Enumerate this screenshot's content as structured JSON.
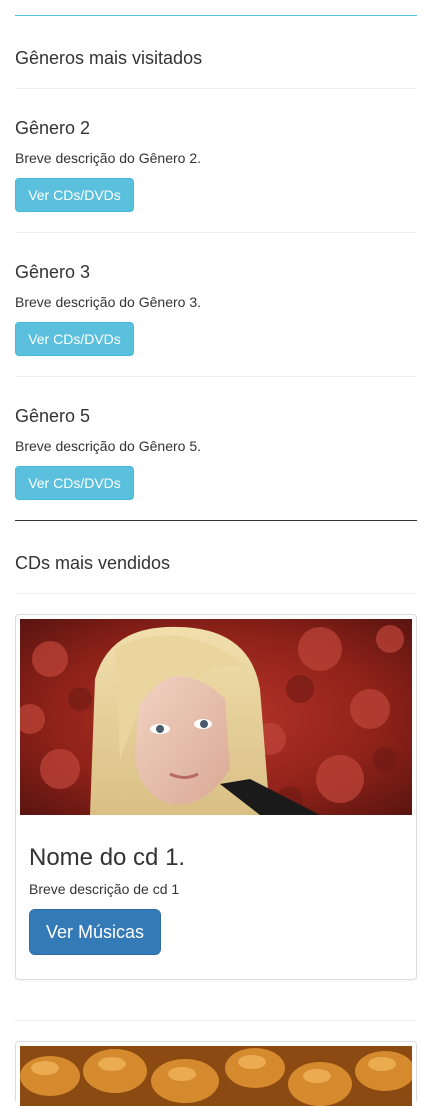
{
  "genres_section": {
    "title": "Gêneros mais visitados",
    "items": [
      {
        "name": "Gênero 2",
        "description": "Breve descrição do Gênero 2.",
        "button": "Ver CDs/DVDs"
      },
      {
        "name": "Gênero 3",
        "description": "Breve descrição do Gênero 3.",
        "button": "Ver CDs/DVDs"
      },
      {
        "name": "Gênero 5",
        "description": "Breve descrição do Gênero 5.",
        "button": "Ver CDs/DVDs"
      }
    ]
  },
  "cds_section": {
    "title": "CDs mais vendidos",
    "items": [
      {
        "name": "Nome do cd 1.",
        "description": "Breve descrição de cd 1",
        "button": "Ver Músicas"
      }
    ]
  },
  "colors": {
    "info": "#5bc0de",
    "primary": "#337ab7",
    "text": "#333333"
  }
}
